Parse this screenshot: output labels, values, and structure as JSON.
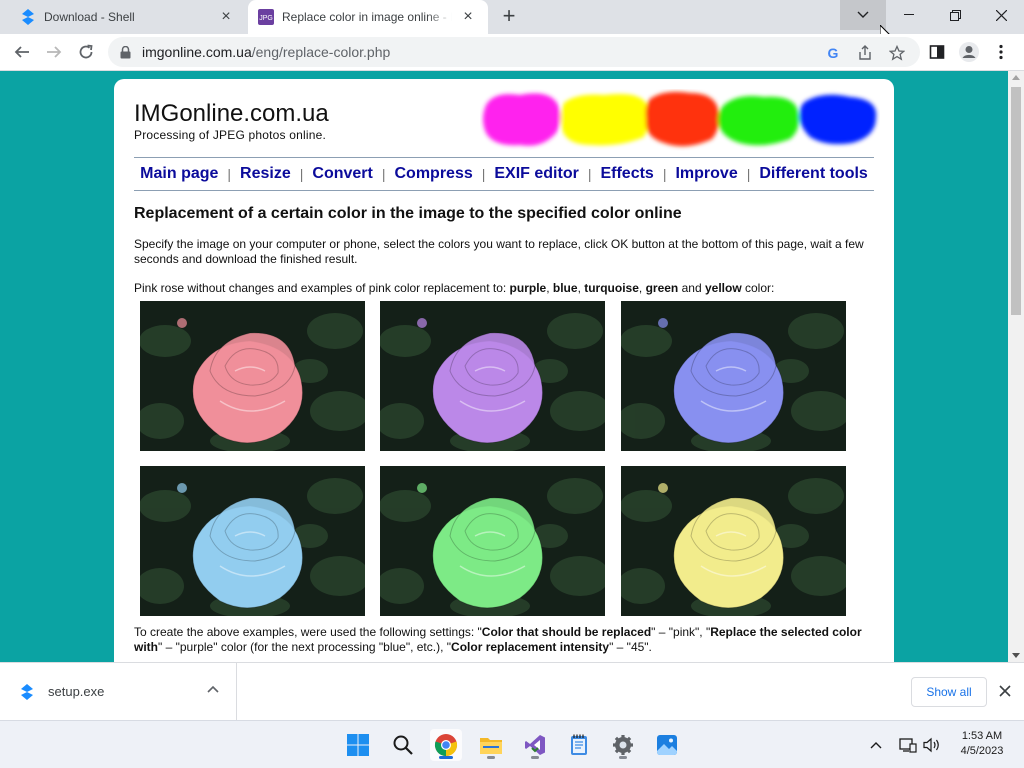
{
  "browser": {
    "tabs": [
      {
        "title": "Download - Shell",
        "active": false,
        "favicon": "shell-download-icon"
      },
      {
        "title": "Replace color in image online - IMG",
        "active": true,
        "favicon": "jpg-icon",
        "favicon_text": "JPG"
      }
    ],
    "new_tab_icon": "plus-icon",
    "window_controls": [
      "tab-search-icon",
      "minimize-icon",
      "restore-icon",
      "close-icon"
    ],
    "nav": {
      "back": "back-arrow-icon",
      "forward": "forward-arrow-icon",
      "reload": "reload-icon"
    },
    "url": {
      "host": "imgonline.com.ua",
      "path": "/eng/replace-color.php"
    },
    "omnibox_icons": [
      "google-lens-icon",
      "share-icon",
      "bookmark-star-icon"
    ],
    "toolbar_icons": [
      "side-panel-icon",
      "profile-icon",
      "more-menu-icon"
    ]
  },
  "site": {
    "title": "IMGonline.com.ua",
    "subtitle": "Processing of JPEG photos online.",
    "blob_colors": [
      "#ff22ee",
      "#ffff00",
      "#ff3311",
      "#22ee11",
      "#0022ff"
    ],
    "menu": [
      "Main page",
      "Resize",
      "Convert",
      "Compress",
      "EXIF editor",
      "Effects",
      "Improve",
      "Different tools"
    ],
    "menu_separator": "|",
    "heading": "Replacement of a certain color in the image to the specified color online",
    "intro": "Specify the image on your computer or phone, select the colors you want to replace, click OK button at the bottom of this page, wait a few seconds and download the finished result.",
    "examples_line": {
      "prefix": "Pink rose without changes and examples of pink color replacement to: ",
      "c1": "purple",
      "s1": ", ",
      "c2": "blue",
      "s2": ", ",
      "c3": "turquoise",
      "s3": ", ",
      "c4": "green",
      "s4": " and ",
      "c5": "yellow",
      "suffix": " color:"
    },
    "roses": [
      {
        "name": "pink",
        "color": "#f08f9a"
      },
      {
        "name": "purple",
        "color": "#bb88e8"
      },
      {
        "name": "blue",
        "color": "#8890f0"
      },
      {
        "name": "turquoise",
        "color": "#92cdef"
      },
      {
        "name": "green",
        "color": "#7dea86"
      },
      {
        "name": "yellow",
        "color": "#f2ec8c"
      }
    ],
    "settings_line": {
      "t1": "To create the above examples, were used the following settings: \"",
      "b1": "Color that should be replaced",
      "t2": "\" – \"pink\", \"",
      "b2": "Replace the selected color with",
      "t3": "\" – \"purple\" color (for the next processing \"blue\", etc.), \"",
      "b3": "Color replacement intensity",
      "t4": "\" – \"45\"."
    }
  },
  "downloads": {
    "file": "setup.exe",
    "show_all": "Show all"
  },
  "taskbar": {
    "apps": [
      "windows-start-icon",
      "search-icon",
      "chrome-icon",
      "file-explorer-icon",
      "visual-studio-installer-icon",
      "notepad-icon",
      "settings-icon",
      "photos-icon"
    ],
    "tray": [
      "chevron-up-icon",
      "network-icon",
      "volume-icon"
    ],
    "time": "1:53 AM",
    "date": "4/5/2023"
  }
}
